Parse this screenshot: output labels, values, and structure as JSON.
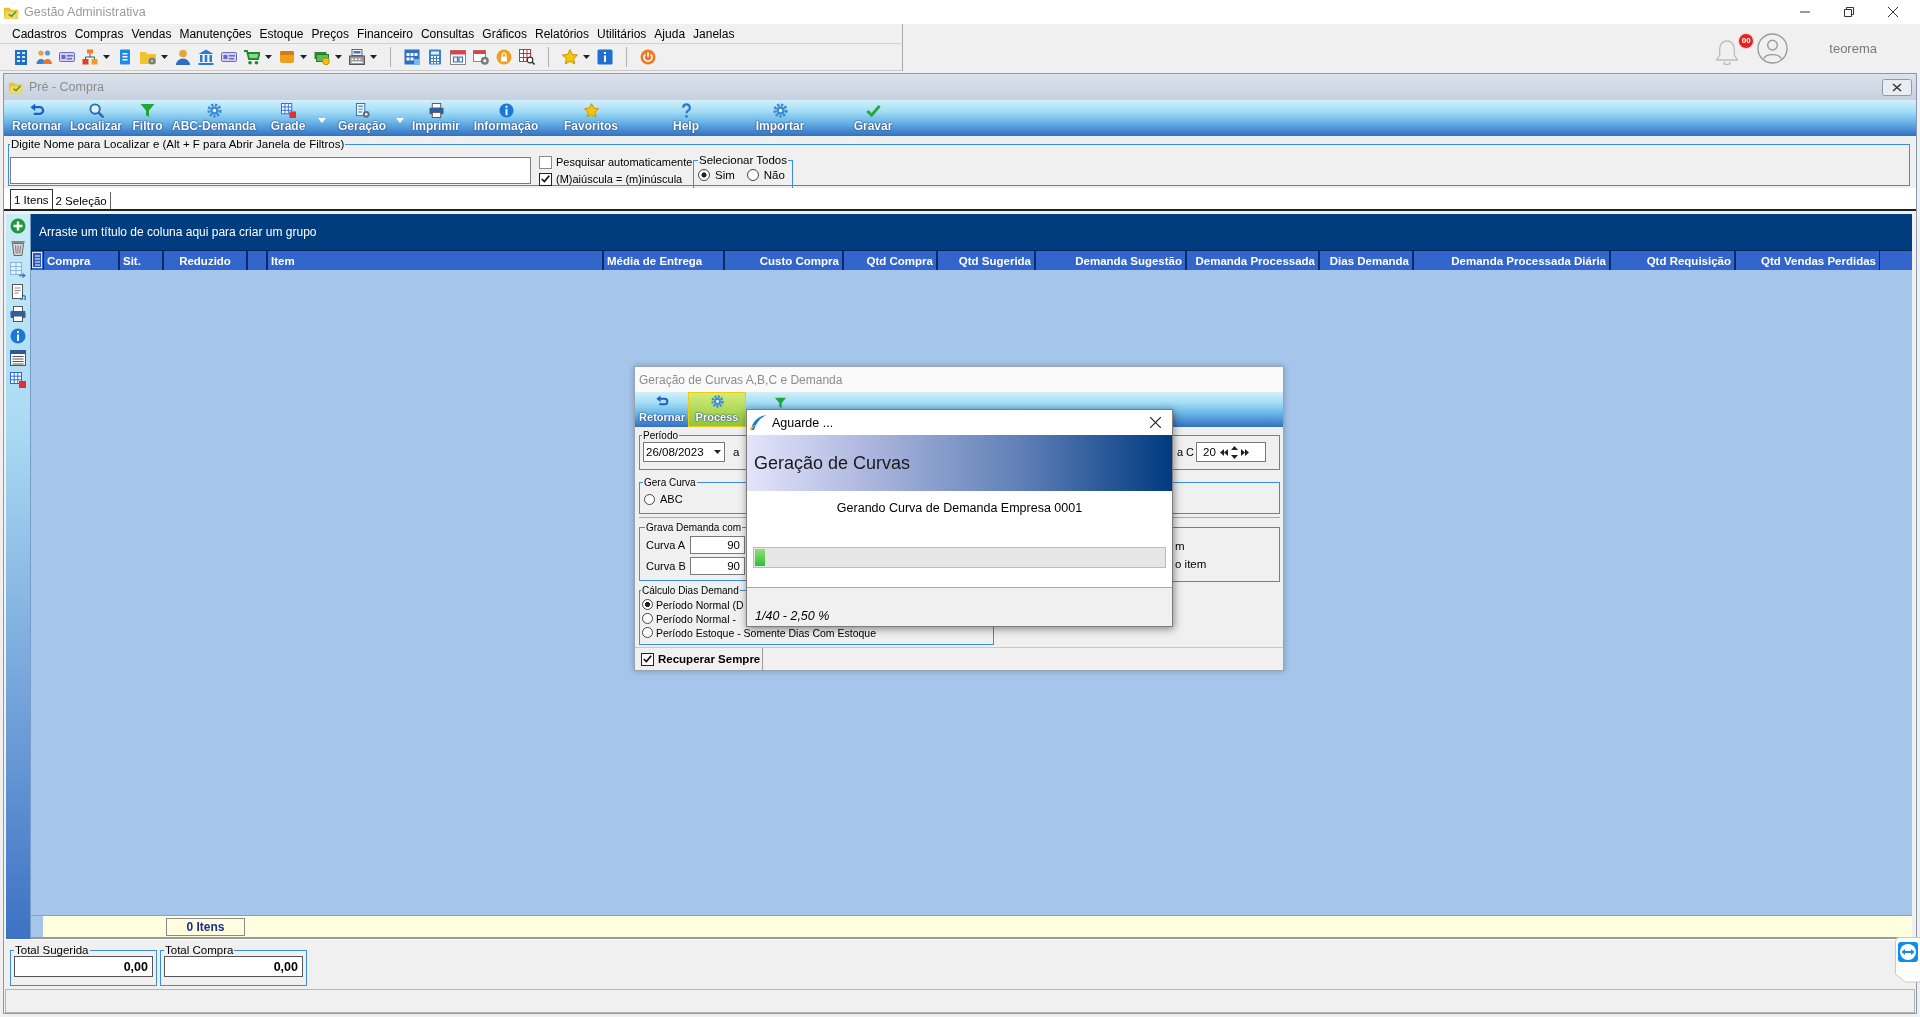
{
  "window": {
    "title": "Gestão Administrativa"
  },
  "menu": [
    "Cadastros",
    "Compras",
    "Vendas",
    "Manutenções",
    "Estoque",
    "Preços",
    "Financeiro",
    "Consultas",
    "Gráficos",
    "Relatórios",
    "Utilitários",
    "Ajuda",
    "Janelas"
  ],
  "user": {
    "notifications": "00",
    "name": "teorema"
  },
  "child_window": {
    "title": "Pré - Compra"
  },
  "toolbar": [
    {
      "label": "Retornar",
      "kind": "button"
    },
    {
      "label": "Localizar",
      "kind": "button"
    },
    {
      "label": "Filtro",
      "kind": "button"
    },
    {
      "label": "ABC-Demanda",
      "kind": "button"
    },
    {
      "label": "Grade",
      "kind": "split"
    },
    {
      "label": "Geração",
      "kind": "split"
    },
    {
      "label": "Imprimir",
      "kind": "button"
    },
    {
      "label": "Informação",
      "kind": "button"
    },
    {
      "label": "Favoritos",
      "kind": "button"
    },
    {
      "label": "Help",
      "kind": "button"
    },
    {
      "label": "Importar",
      "kind": "button"
    },
    {
      "label": "Gravar",
      "kind": "button"
    }
  ],
  "search": {
    "legend": "Digite Nome para Localizar e (Alt + F para Abrir Janela de Filtros)",
    "options": [
      {
        "label": "Pesquisar automaticamente",
        "checked": false
      },
      {
        "label": "(M)aiúscula = (m)inúscula",
        "checked": true
      }
    ],
    "select_all": {
      "legend": "Selecionar Todos",
      "options": [
        {
          "label": "Sim",
          "selected": true
        },
        {
          "label": "Não",
          "selected": false
        }
      ]
    }
  },
  "tabs": [
    {
      "label": "1 Itens",
      "selected": true
    },
    {
      "label": "2 Seleção",
      "selected": false
    }
  ],
  "grid": {
    "group_hint": "Arraste um título de coluna aqui para criar um grupo",
    "columns": [
      {
        "label": "Compra",
        "kind": "text"
      },
      {
        "label": "Sit.",
        "kind": "text"
      },
      {
        "label": "Reduzido",
        "kind": "code"
      },
      {
        "kind": "blank"
      },
      {
        "label": "Item",
        "kind": "text"
      },
      {
        "label": "Média de Entrega",
        "kind": "text"
      },
      {
        "label": "Custo Compra",
        "kind": "number"
      },
      {
        "label": "Qtd Compra",
        "kind": "number"
      },
      {
        "label": "Qtd Sugerida",
        "kind": "number"
      },
      {
        "label": "Demanda Sugestão",
        "kind": "number"
      },
      {
        "label": "Demanda Processada",
        "kind": "number"
      },
      {
        "label": "Dias Demanda",
        "kind": "number"
      },
      {
        "label": "Demanda Processada Diária",
        "kind": "number"
      },
      {
        "label": "Qtd Requisição",
        "kind": "number"
      },
      {
        "label": "Qtd Vendas Perdidas",
        "kind": "number"
      }
    ],
    "footer_count": "0 Itens"
  },
  "totals": [
    {
      "label": "Total Sugerida",
      "value": "0,00"
    },
    {
      "label": "Total Compra",
      "value": "0,00"
    }
  ],
  "curves_dialog": {
    "title": "Geração de Curvas A,B,C e Demanda",
    "toolbar": [
      {
        "label": "Retornar",
        "highlighted": false
      },
      {
        "label": "Process",
        "highlighted": true
      }
    ],
    "period": {
      "legend": "Período",
      "date_from": "26/08/2023",
      "separator": "a",
      "curve_c_label": "a C",
      "curve_c_value": "20"
    },
    "generate_curve": {
      "legend": "Gera Curva",
      "options": [
        {
          "label": "ABC",
          "selected": false
        }
      ]
    },
    "save_demand": {
      "legend": "Grava Demanda com",
      "fields": [
        {
          "label": "Curva A",
          "value": "90"
        },
        {
          "label": "Curva B",
          "value": "90"
        }
      ]
    },
    "side_texts": [
      "m",
      "o item"
    ],
    "days_calc": {
      "legend": "Cálculo Dias Demand",
      "options": [
        {
          "label": "Período Normal (D",
          "selected": true
        },
        {
          "label": "Período Normal -",
          "selected": false
        },
        {
          "label": "Período Estoque - Somente Dias Com Estoque",
          "selected": false
        }
      ]
    },
    "recover_always": {
      "label": "Recuperar Sempre",
      "checked": true
    }
  },
  "progress_dialog": {
    "title": "Aguarde ...",
    "heading": "Geração de Curvas",
    "message": "Gerando Curva de Demanda Empresa 0001",
    "level": 0.025,
    "status": "1/40 - 2,50 %"
  }
}
